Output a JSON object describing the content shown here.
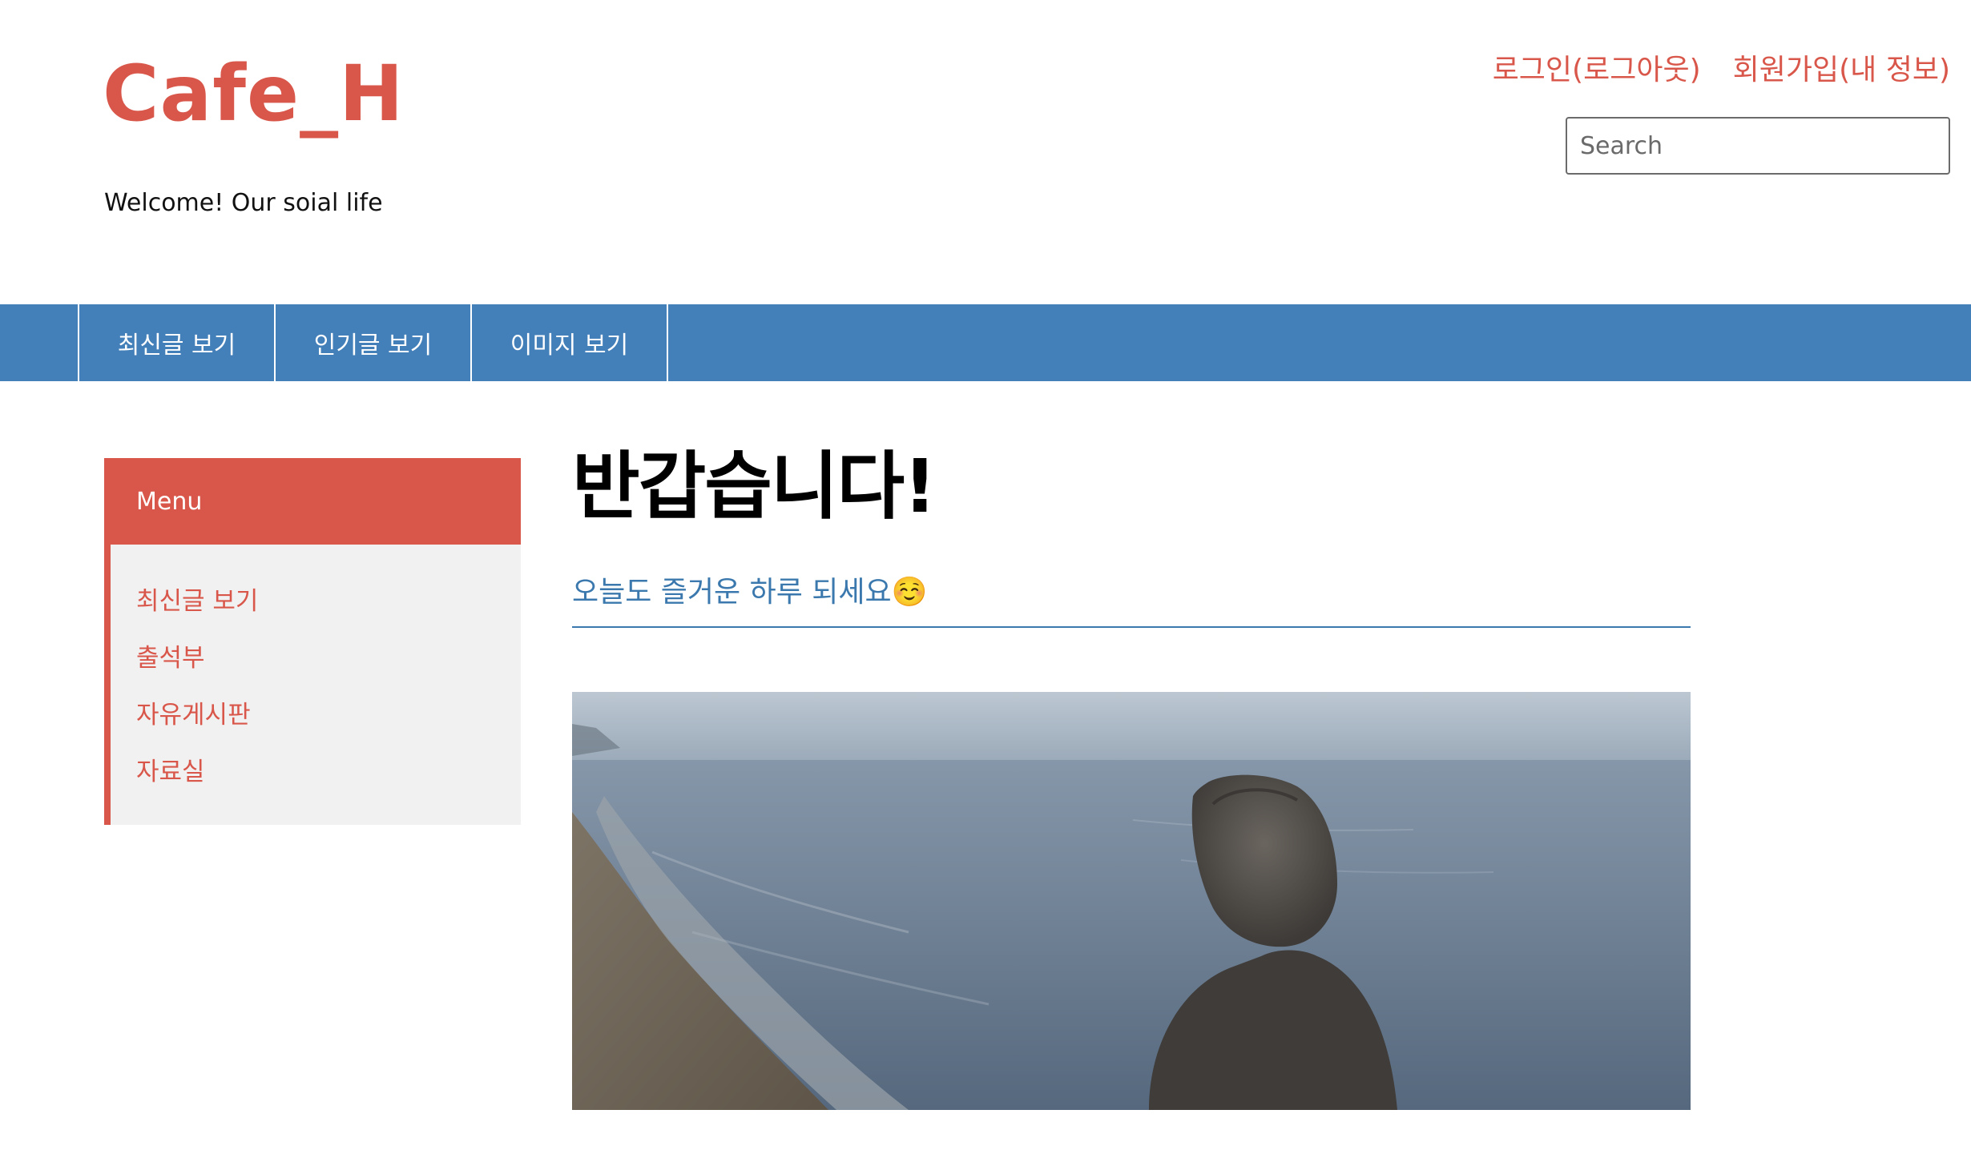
{
  "brand": {
    "title": "Cafe_H",
    "subtitle": "Welcome! Our soial life"
  },
  "top_links": {
    "login": "로그인(로그아웃)",
    "signup": "회원가입(내 정보)"
  },
  "search": {
    "placeholder": "Search"
  },
  "nav": {
    "items": [
      "최신글 보기",
      "인기글 보기",
      "이미지 보기"
    ]
  },
  "sidebar": {
    "header": "Menu",
    "items": [
      "최신글 보기",
      "출석부",
      "자유게시판",
      "자료실"
    ]
  },
  "main": {
    "title": "반갑습니다!",
    "subtitle": "오늘도 즐거운 하루 되세요☺️"
  },
  "colors": {
    "accent": "#d9574a",
    "nav": "#437fb8",
    "subtitle": "#3a78ad",
    "sidebar_bg": "#f1f1f1"
  },
  "hero_image": {
    "icon": "hooded-person-beach-photo"
  }
}
